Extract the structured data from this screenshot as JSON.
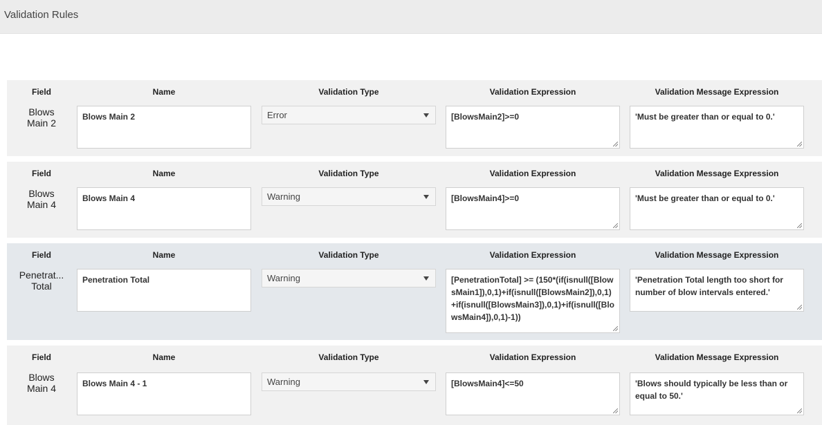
{
  "header": {
    "title": "Validation Rules"
  },
  "columns": {
    "field": "Field",
    "name": "Name",
    "type": "Validation Type",
    "expression": "Validation Expression",
    "message": "Validation Message Expression"
  },
  "rules": [
    {
      "field_line1": "Blows",
      "field_line2": "Main 2",
      "name": "Blows Main 2",
      "type": "Error",
      "expression": "[BlowsMain2]>=0",
      "message": "'Must be greater than or equal to 0.'"
    },
    {
      "field_line1": "Blows",
      "field_line2": "Main 4",
      "name": "Blows Main 4",
      "type": "Warning",
      "expression": "[BlowsMain4]>=0",
      "message": "'Must be greater than or equal to 0.'"
    },
    {
      "field_line1": "Penetrat...",
      "field_line2": "Total",
      "name": "Penetration Total",
      "type": "Warning",
      "expression": "[PenetrationTotal] >= (150*(if(isnull([BlowsMain1]),0,1)+if(isnull([BlowsMain2]),0,1)+if(isnull([BlowsMain3]),0,1)+if(isnull([BlowsMain4]),0,1)-1))",
      "message": "'Penetration Total length too short for number of blow intervals entered.'"
    },
    {
      "field_line1": "Blows",
      "field_line2": "Main 4",
      "name": "Blows Main 4 - 1",
      "type": "Warning",
      "expression": "[BlowsMain4]<=50",
      "message": "'Blows should typically be less than or equal to 50.'"
    }
  ]
}
